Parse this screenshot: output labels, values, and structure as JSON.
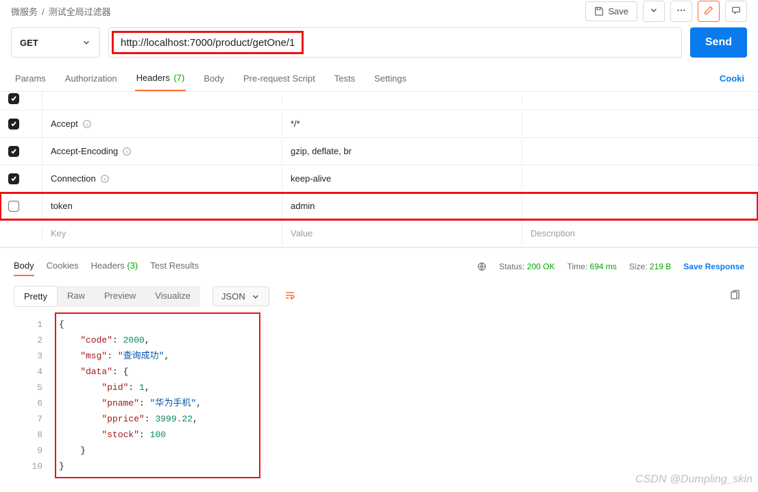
{
  "breadcrumb": {
    "workspace": "微服务",
    "name": "测试全局过滤器"
  },
  "topActions": {
    "save": "Save"
  },
  "request": {
    "method": "GET",
    "url": "http://localhost:7000/product/getOne/1",
    "send": "Send"
  },
  "reqTabs": {
    "params": "Params",
    "auth": "Authorization",
    "headers": "Headers",
    "headersCount": "(7)",
    "body": "Body",
    "preReq": "Pre-request Script",
    "tests": "Tests",
    "settings": "Settings",
    "cookies": "Cooki"
  },
  "headersRows": [
    {
      "checked": true,
      "key": "",
      "value": ""
    },
    {
      "checked": true,
      "key": "Accept",
      "value": "*/*",
      "info": true
    },
    {
      "checked": true,
      "key": "Accept-Encoding",
      "value": "gzip, deflate, br",
      "info": true
    },
    {
      "checked": true,
      "key": "Connection",
      "value": "keep-alive",
      "info": true
    },
    {
      "checked": false,
      "key": "token",
      "value": "admin",
      "outlined": true
    }
  ],
  "headersPlaceholder": {
    "key": "Key",
    "value": "Value",
    "desc": "Description"
  },
  "respTabs": {
    "body": "Body",
    "cookies": "Cookies",
    "headers": "Headers",
    "headersCount": "(3)",
    "tests": "Test Results"
  },
  "respStatus": {
    "statusLabel": "Status:",
    "statusVal": "200 OK",
    "timeLabel": "Time:",
    "timeVal": "694 ms",
    "sizeLabel": "Size:",
    "sizeVal": "219 B",
    "save": "Save Response"
  },
  "viewTabs": {
    "pretty": "Pretty",
    "raw": "Raw",
    "preview": "Preview",
    "visualize": "Visualize",
    "format": "JSON"
  },
  "json": {
    "l1": "{",
    "l2a": "    \"code\"",
    "l2b": ": ",
    "l2c": "2000",
    "l2d": ",",
    "l3a": "    \"msg\"",
    "l3b": ": ",
    "l3c": "\"查询成功\"",
    "l3d": ",",
    "l4a": "    \"data\"",
    "l4b": ": {",
    "l5a": "        \"pid\"",
    "l5b": ": ",
    "l5c": "1",
    "l5d": ",",
    "l6a": "        \"pname\"",
    "l6b": ": ",
    "l6c": "\"华为手机\"",
    "l6d": ",",
    "l7a": "        \"pprice\"",
    "l7b": ": ",
    "l7c": "3999.22",
    "l7d": ",",
    "l8a": "        \"stock\"",
    "l8b": ": ",
    "l8c": "100",
    "l9": "    }",
    "l10": "}"
  },
  "lineNums": [
    "1",
    "2",
    "3",
    "4",
    "5",
    "6",
    "7",
    "8",
    "9",
    "10"
  ],
  "watermark": "CSDN @Dumpling_skin"
}
